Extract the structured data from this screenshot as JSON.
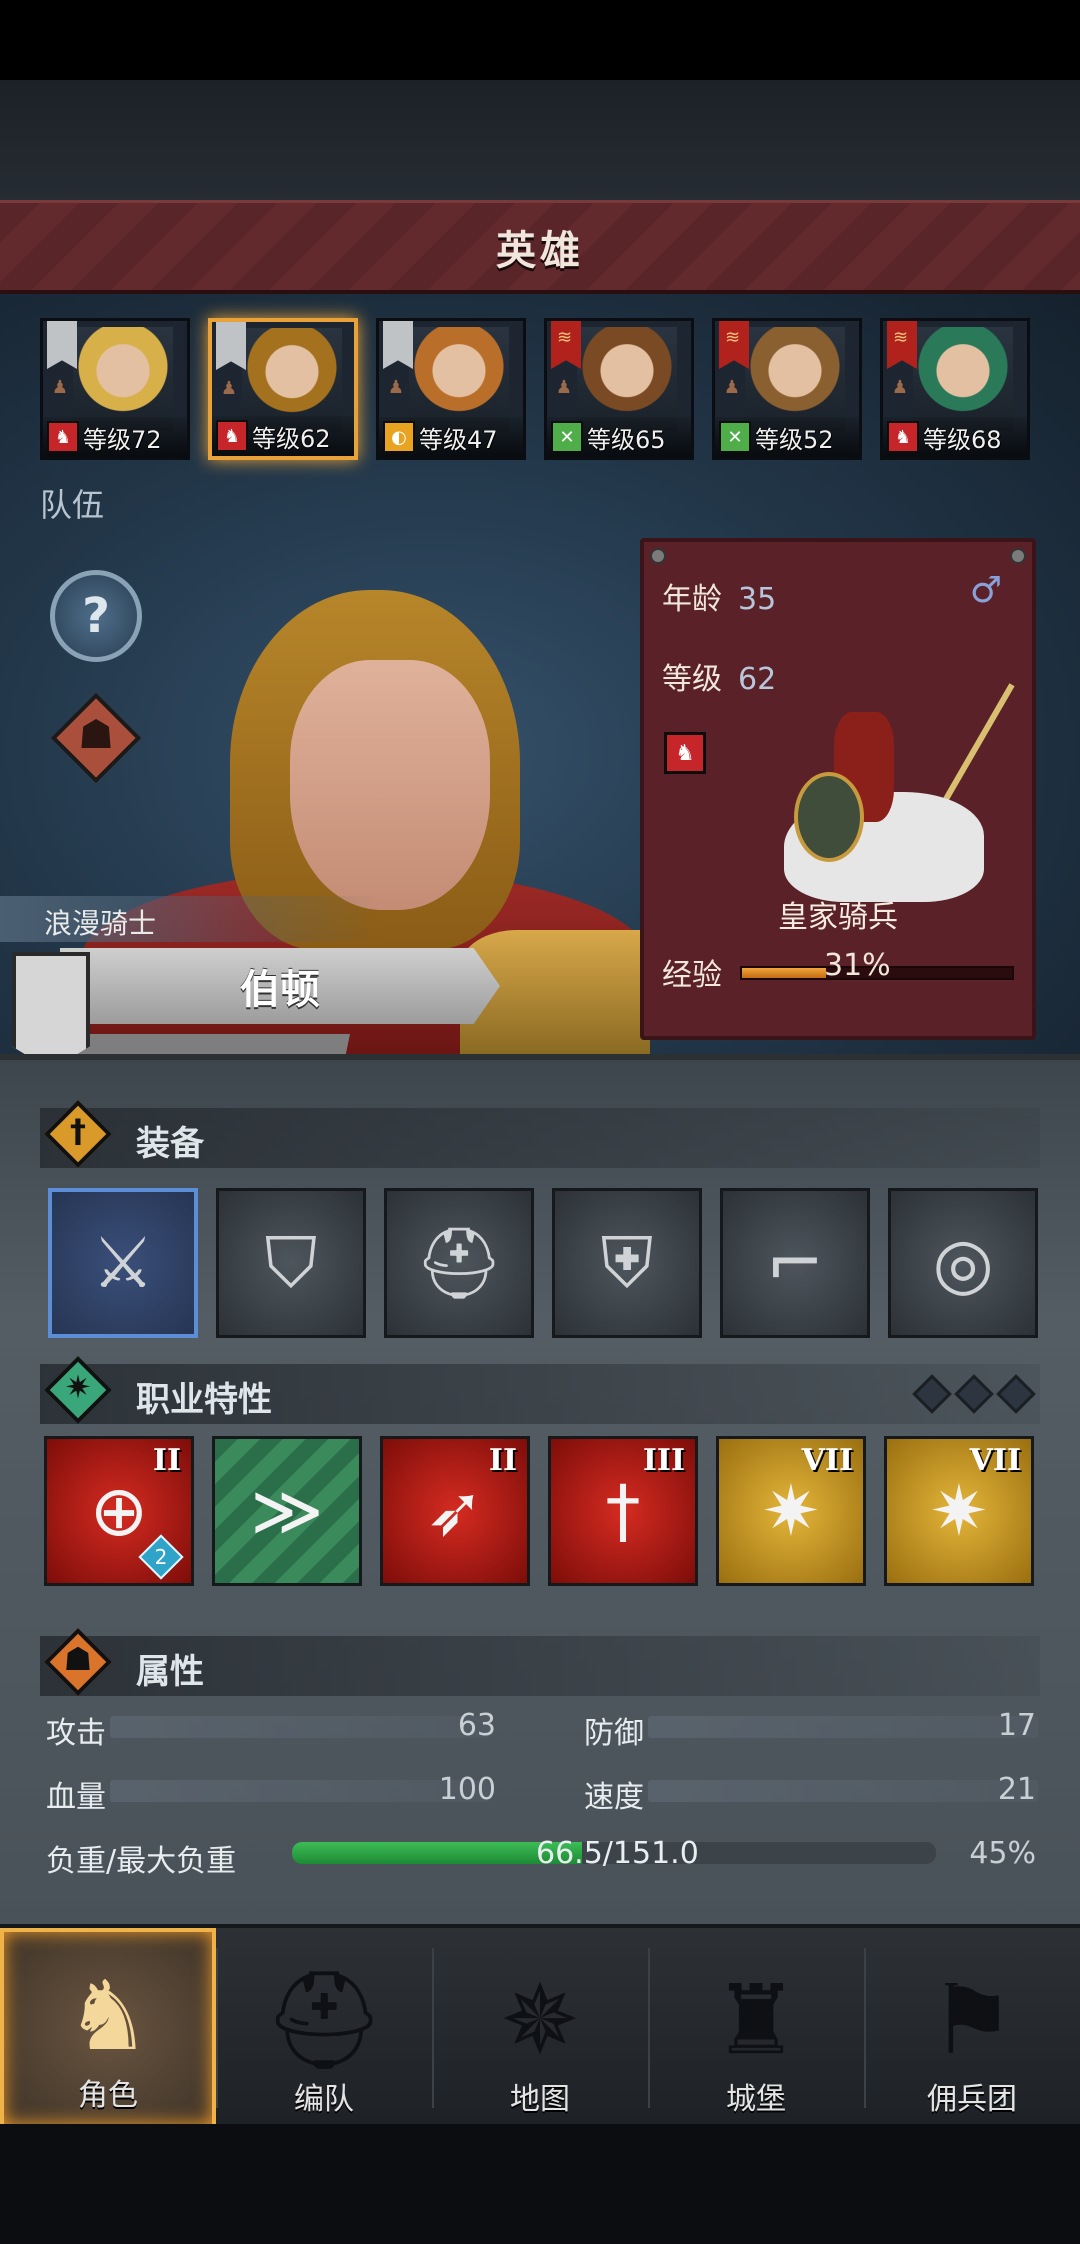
{
  "header": {
    "title": "英雄"
  },
  "roster": [
    {
      "level": "等级72",
      "pennant": "grey",
      "unit_class": "horse-icon",
      "hair": "#d8b04a"
    },
    {
      "level": "等级62",
      "pennant": "grey",
      "unit_class": "horse-icon",
      "hair": "#a4721e",
      "selected": true
    },
    {
      "level": "等级47",
      "pennant": "grey",
      "unit_class": "shield-icon",
      "hair": "#b96f2a"
    },
    {
      "level": "等级65",
      "pennant": "red",
      "unit_class": "cross-icon",
      "hair": "#7a4a24"
    },
    {
      "level": "等级52",
      "pennant": "red",
      "unit_class": "cross-icon",
      "hair": "#8a6030"
    },
    {
      "level": "等级68",
      "pennant": "red",
      "unit_class": "horse-icon",
      "hair": "#2a7a5a"
    }
  ],
  "team_label": "队伍",
  "help_glyph": "?",
  "hero": {
    "class_name": "浪漫骑士",
    "name": "伯顿"
  },
  "info": {
    "age_label": "年龄",
    "age": "35",
    "gender_symbol": "♂",
    "level_label": "等级",
    "level": "62",
    "unit_name": "皇家骑兵",
    "exp_label": "经验",
    "exp_percent": "31%",
    "exp_fraction": 0.31
  },
  "equipment": {
    "title": "装备",
    "items": [
      {
        "name": "sword-icon",
        "glyph": "⚔",
        "selected": true
      },
      {
        "name": "shield-icon",
        "glyph": "⛉"
      },
      {
        "name": "helmet-icon",
        "glyph": "⛑"
      },
      {
        "name": "armor-icon",
        "glyph": "🛡"
      },
      {
        "name": "boots-icon",
        "glyph": "👢"
      },
      {
        "name": "ring-icon",
        "glyph": "◎"
      }
    ]
  },
  "traits": {
    "title": "职业特性",
    "items": [
      {
        "name": "charge-target-icon",
        "glyph": "⊕",
        "color": "red",
        "rank": "II",
        "badge": "2"
      },
      {
        "name": "horse-wind-icon",
        "glyph": "≫",
        "color": "green",
        "rank": ""
      },
      {
        "name": "shield-arrow-icon",
        "glyph": "➶",
        "color": "red",
        "rank": "II"
      },
      {
        "name": "sword-icon",
        "glyph": "🗡",
        "color": "red",
        "rank": "III"
      },
      {
        "name": "shield-burst-icon",
        "glyph": "✷",
        "color": "gold",
        "rank": "VII"
      },
      {
        "name": "shield-burst-icon",
        "glyph": "✷",
        "color": "gold",
        "rank": "VII"
      }
    ]
  },
  "attributes": {
    "title": "属性",
    "attack_label": "攻击",
    "attack": "63",
    "defense_label": "防御",
    "defense": "17",
    "hp_label": "血量",
    "hp": "100",
    "speed_label": "速度",
    "speed": "21",
    "load_label": "负重/最大负重",
    "load_value": "66.5/151.0",
    "load_percent": "45%",
    "load_fraction": 0.45
  },
  "nav": [
    {
      "label": "角色",
      "icon": "knight-icon",
      "glyph": "♞",
      "active": true
    },
    {
      "label": "编队",
      "icon": "helmet-icon",
      "glyph": "⛑"
    },
    {
      "label": "地图",
      "icon": "compass-icon",
      "glyph": "✵"
    },
    {
      "label": "城堡",
      "icon": "castle-icon",
      "glyph": "♜"
    },
    {
      "label": "佣兵团",
      "icon": "banner-icon",
      "glyph": "⚑"
    }
  ],
  "colors": {
    "accent": "#e9a23a",
    "banner": "#5a2529",
    "exp": "#f3a63a",
    "load": "#3dbd56"
  }
}
